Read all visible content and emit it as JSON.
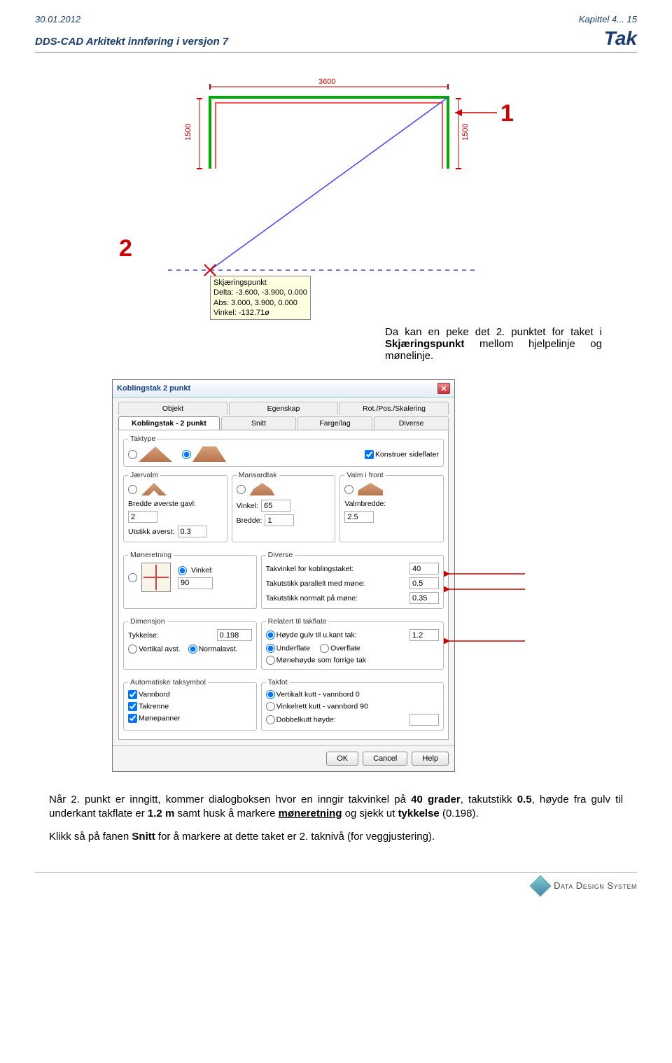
{
  "header": {
    "date": "30.01.2012",
    "chapter": "Kapittel 4... 15",
    "subtitle": "DDS-CAD Arkitekt innføring i versjon 7",
    "page_title": "Tak"
  },
  "cad": {
    "callout1": "1",
    "callout2": "2",
    "dim_top": "3600",
    "dim_left": "1500",
    "dim_right": "1500",
    "tooltip_title": "Skjæringspunkt",
    "tooltip_delta": "Delta: -3.600, -3.900, 0.000",
    "tooltip_abs": "Abs: 3.000, 3.900, 0.000",
    "tooltip_vinkel": "Vinkel: -132.71ø"
  },
  "para1_pre": "Da kan en peke det 2. punktet for taket i ",
  "para1_bold": "Skjæringspunkt",
  "para1_post": " mellom hjelpelinje og mønelinje.",
  "dialog": {
    "title": "Koblingstak 2 punkt",
    "tabs_row1": [
      "Objekt",
      "Egenskap",
      "Rot./Pos./Skalering"
    ],
    "tabs_row2": [
      "Koblingstak - 2 punkt",
      "Snitt",
      "Farge/lag",
      "Diverse"
    ],
    "tabs_row2_active": 0,
    "taktype_legend": "Taktype",
    "konstr_sideflater": "Konstruer sideflater",
    "threecols": {
      "jaervalm": "Jærvalm",
      "mansard": "Mansardtak",
      "valmfront": "Valm i front",
      "bredde_overste_label": "Bredde øverste gavl:",
      "bredde_overste": "2",
      "utstikk_overst_label": "Utstikk øverst:",
      "utstikk_overst": "0.3",
      "vinkel_label": "Vinkel:",
      "vinkel": "65",
      "bredde_label": "Bredde:",
      "bredde": "1",
      "valmbredde_label": "Valmbredde:",
      "valmbredde": "2.5"
    },
    "moneretning_legend": "Møneretning",
    "vinkel_radio_label": "Vinkel:",
    "vinkel_90": "90",
    "diverse_legend": "Diverse",
    "takvinkel_label": "Takvinkel for koblingstaket:",
    "takvinkel": "40",
    "takutst_par_label": "Takutstikk parallelt med møne:",
    "takutst_par": "0.5",
    "takutst_norm_label": "Takutstikk normalt på møne:",
    "takutst_norm": "0.35",
    "dimensjon_legend": "Dimensjon",
    "tykkelse_label": "Tykkelse:",
    "tykkelse": "0.198",
    "vert_avst": "Vertikal avst.",
    "normal_avst": "Normalavst.",
    "relatert_legend": "Relatert til takflate",
    "hoyde_gulv_label": "Høyde gulv til u.kant tak:",
    "hoyde_gulv": "1.2",
    "underflate": "Underflate",
    "overflate": "Overflate",
    "monehoyde": "Mønehøyde som forrige tak",
    "autotak_legend": "Automatiske taksymbol",
    "vannbord": "Vannbord",
    "takrenne": "Takrenne",
    "monepanner": "Mønepanner",
    "takfot_legend": "Takfot",
    "vertkutt": "Vertikalt kutt - vannbord 0",
    "vinkelkutt": "Vinkelrett kutt - vannbord 90",
    "dobbelkutt_label": "Dobbelkutt høyde:",
    "dobbelkutt": "",
    "ok": "OK",
    "cancel": "Cancel",
    "help": "Help"
  },
  "para2": {
    "p1a": "Når 2. punkt er inngitt, kommer dialogboksen hvor en inngir takvinkel på ",
    "p1b": "40 grader",
    "p1c": ", takutstikk ",
    "p1d": "0.5",
    "p1e": ", høyde fra gulv til underkant takflate er ",
    "p1f": "1.2 m",
    "p1g": " samt husk å markere ",
    "p1h": "møneretning",
    "p1i": " og sjekk ut ",
    "p1j": "tykkelse",
    "p1k": " (0.198).",
    "p2a": "Klikk så på fanen ",
    "p2b": "Snitt",
    "p2c": " for å markere at dette taket er 2. taknivå (for veggjustering)."
  },
  "footer": {
    "brand": "Data Design System"
  }
}
